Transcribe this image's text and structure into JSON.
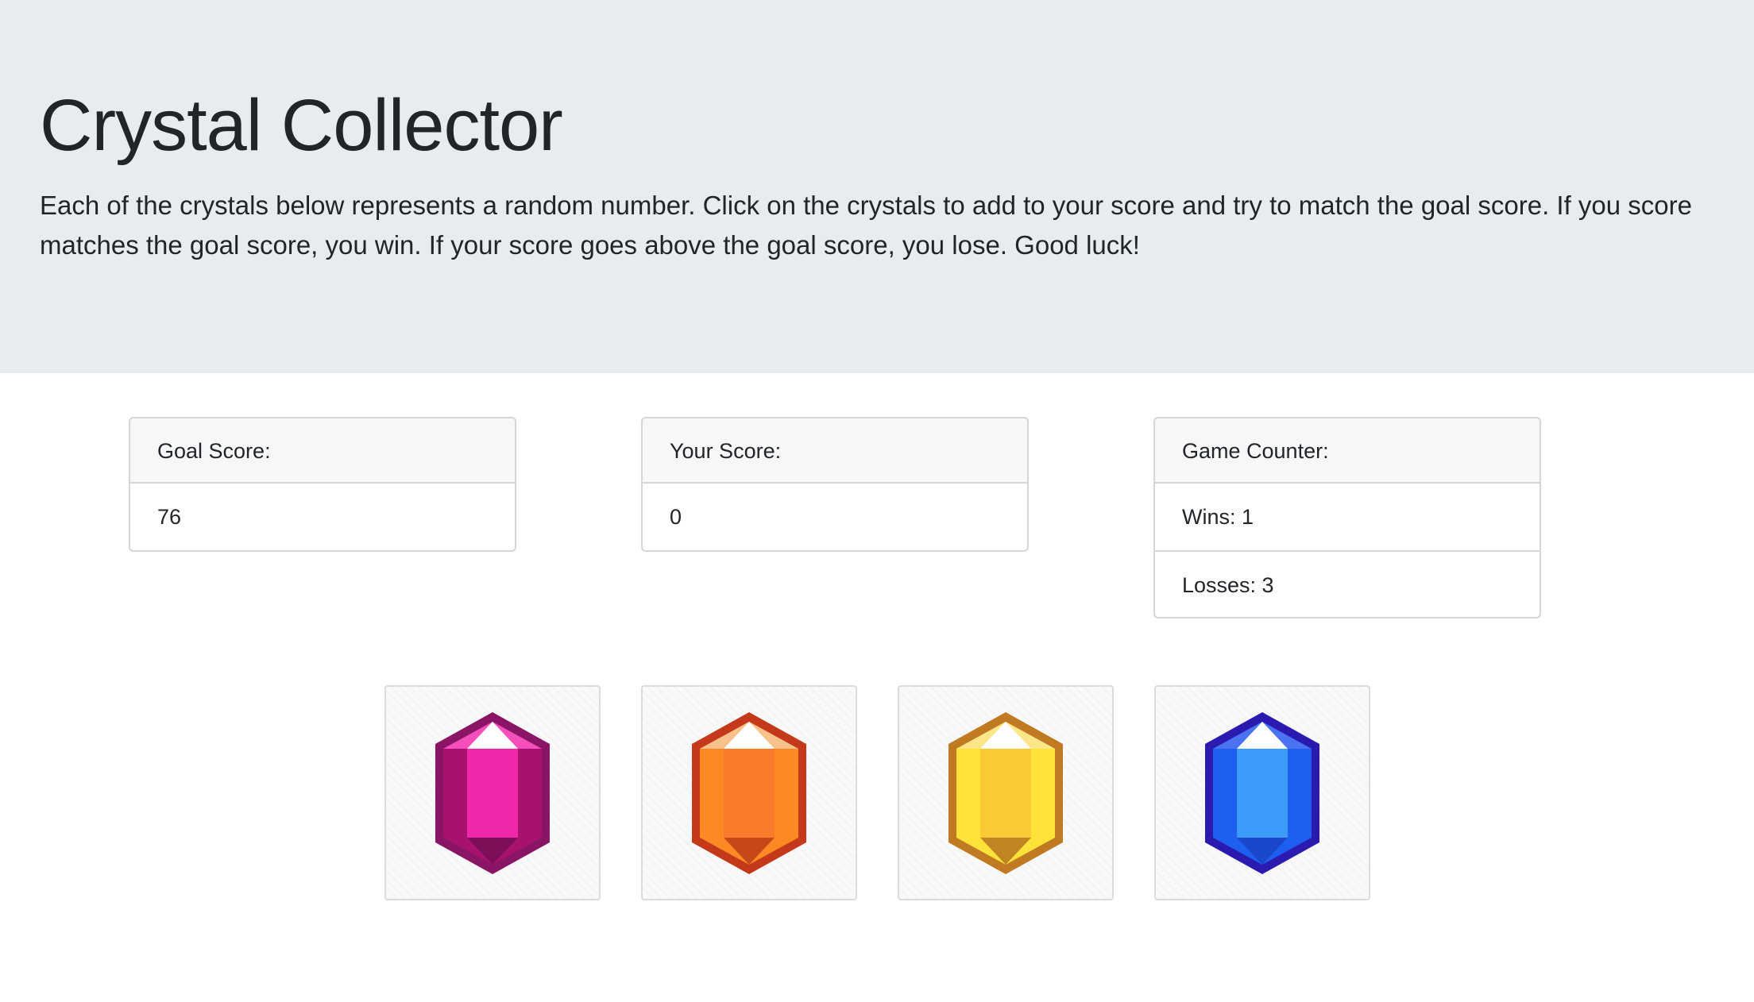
{
  "header": {
    "title": "Crystal Collector",
    "description": "Each of the crystals below represents a random number. Click on the crystals to add to your score and try to match the goal score. If you score matches the goal score, you win. If your score goes above the goal score, you lose. Good luck!"
  },
  "goal_card": {
    "label": "Goal Score:",
    "value": "76"
  },
  "score_card": {
    "label": "Your Score:",
    "value": "0"
  },
  "counter_card": {
    "label": "Game Counter:",
    "wins": "Wins: 1",
    "losses": "Losses: 3"
  },
  "crystals": [
    {
      "name": "pink-crystal-icon",
      "colors": {
        "outline": "#8a1466",
        "dark": "#a8126f",
        "mid": "#f027a8",
        "top": "#f64fbc",
        "tip": "#ffffff",
        "bottom": "#7c0f58"
      }
    },
    {
      "name": "orange-crystal-icon",
      "colors": {
        "outline": "#c4391a",
        "dark": "#fb8a25",
        "mid": "#f97a2a",
        "top": "#f9c28a",
        "tip": "#ffffff",
        "bottom": "#c64818"
      }
    },
    {
      "name": "yellow-crystal-icon",
      "colors": {
        "outline": "#bf7a22",
        "dark": "#fde23a",
        "mid": "#fbc935",
        "top": "#fde58a",
        "tip": "#ffffff",
        "bottom": "#c08522"
      }
    },
    {
      "name": "blue-crystal-icon",
      "colors": {
        "outline": "#2a1ab0",
        "dark": "#1e5ff0",
        "mid": "#3c9bf8",
        "top": "#4a72f2",
        "tip": "#ffffff",
        "bottom": "#1a47cc"
      }
    }
  ]
}
